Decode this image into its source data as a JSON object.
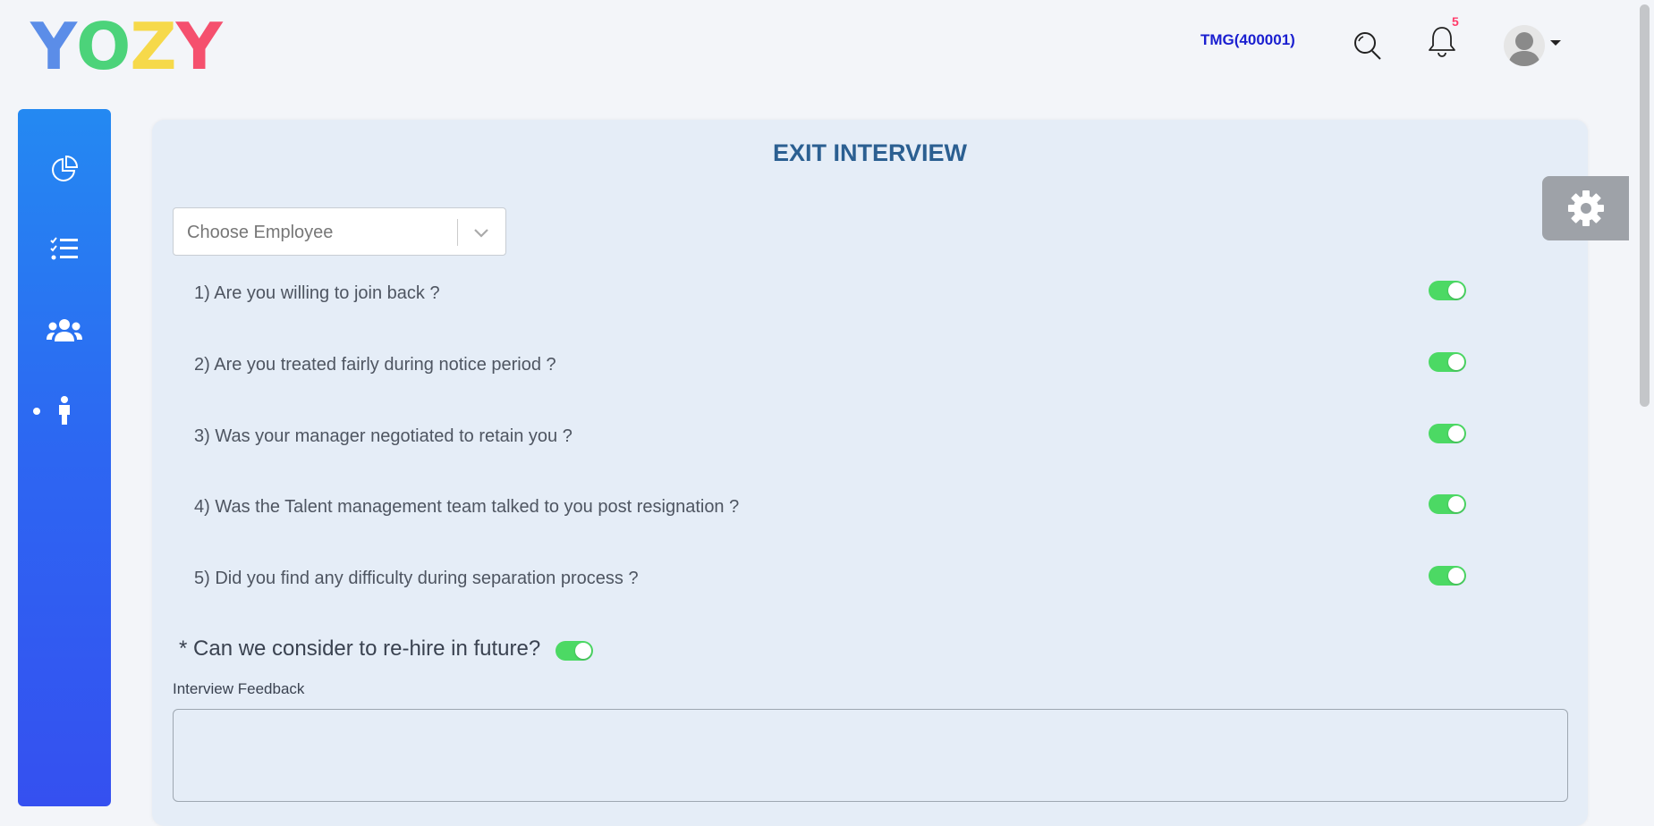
{
  "brand": {
    "logo_letters": [
      {
        "char": "Y",
        "color": "#5b8de8"
      },
      {
        "char": "O",
        "color": "#4cd37a"
      },
      {
        "char": "Z",
        "color": "#f6d94a"
      },
      {
        "char": "Y",
        "color": "#f5506e"
      }
    ]
  },
  "header": {
    "company": "TMG(400001)",
    "notification_count": "5",
    "icons": [
      "search-icon",
      "bell-icon",
      "avatar",
      "caret-down-icon"
    ]
  },
  "sidebar": {
    "items": [
      {
        "name": "dashboard",
        "icon": "pie-chart-icon"
      },
      {
        "name": "tasks",
        "icon": "checklist-icon"
      },
      {
        "name": "team",
        "icon": "users-icon"
      },
      {
        "name": "exit",
        "icon": "person-icon",
        "active": true
      }
    ]
  },
  "main": {
    "title": "EXIT INTERVIEW",
    "employee_select": {
      "placeholder": "Choose Employee"
    },
    "questions": [
      {
        "label": "1) Are you willing to join back ?",
        "on": true
      },
      {
        "label": "2) Are you treated fairly during notice period ?",
        "on": true
      },
      {
        "label": "3) Was your manager negotiated to retain you ?",
        "on": true
      },
      {
        "label": "4) Was the Talent management team talked to you post resignation ?",
        "on": true
      },
      {
        "label": "5) Did you find any difficulty during separation process ?",
        "on": true
      }
    ],
    "rehire": {
      "label": "* Can we consider to re-hire in future?",
      "on": true
    },
    "feedback": {
      "label": "Interview Feedback",
      "value": ""
    }
  },
  "colors": {
    "toggle_on": "#4cd964",
    "title": "#2b5f91",
    "company": "#1a1fd0",
    "sidebar_top": "#2489f2",
    "sidebar_bottom": "#3550f0"
  }
}
